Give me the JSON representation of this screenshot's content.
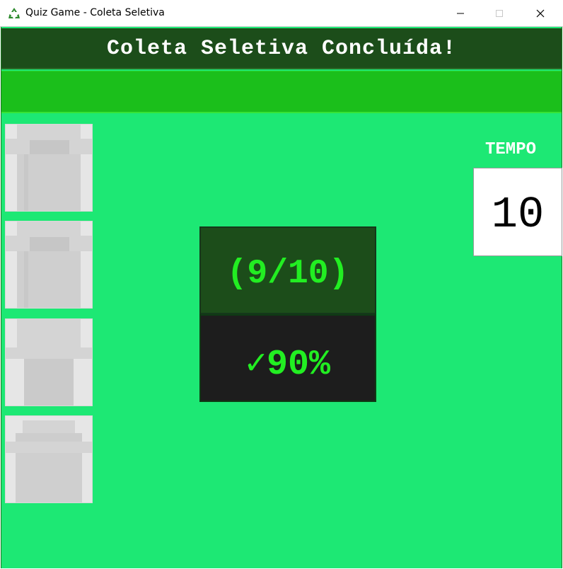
{
  "window": {
    "title": "Quiz Game - Coleta Seletiva",
    "app_icon": "recycle-icon"
  },
  "header": {
    "title": "Coleta Seletiva Concluída!"
  },
  "bins": [
    {
      "name": "trash-bin-1",
      "icon": "bin-icon"
    },
    {
      "name": "trash-bin-2",
      "icon": "bin-icon"
    },
    {
      "name": "trash-bin-3",
      "icon": "bin-icon"
    },
    {
      "name": "trash-bin-4",
      "icon": "bin-icon"
    }
  ],
  "timer": {
    "label": "TEMPO",
    "value": "10"
  },
  "result": {
    "score": "(9/10)",
    "percentage": "✓90%"
  },
  "colors": {
    "background": "#1de874",
    "header": "#1c4d1a",
    "bar": "#1bbf1b",
    "accent_text": "#22ee22",
    "percentage_bg": "#1d1d1d"
  }
}
